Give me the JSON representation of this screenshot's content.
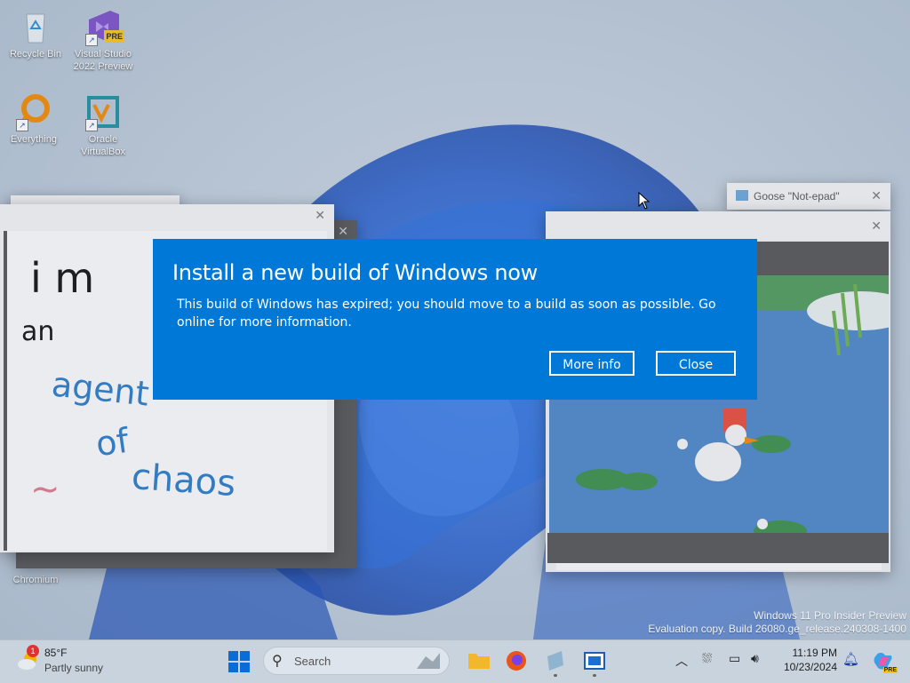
{
  "desktop": {
    "icons": [
      {
        "label_line1": "Recycle Bin",
        "label_line2": ""
      },
      {
        "label_line1": "Visual Studio",
        "label_line2": "2022 Preview",
        "badge": "PRE"
      },
      {
        "label_line1": "Everything",
        "label_line2": ""
      },
      {
        "label_line1": "Oracle",
        "label_line2": "VirtualBox"
      },
      {
        "label_line1": "Chromium",
        "label_line2": ""
      }
    ],
    "watermark_line1": "Windows 11 Pro Insider Preview",
    "watermark_line2": "Evaluation copy. Build 26080.ge_release.240308-1400"
  },
  "notepad_window": {
    "title": "Goose \"Not-epad\""
  },
  "drawing": {
    "line1": "i m",
    "line2": "an",
    "line3": "agent",
    "line4": "of",
    "line5": "chaos",
    "squiggle": "~"
  },
  "dialog": {
    "title": "Install a new build of Windows now",
    "message": "This build of Windows has expired; you should move to a build as soon as possible. Go online for more information.",
    "more_info_label": "More info",
    "close_label": "Close"
  },
  "taskbar": {
    "weather_temp": "85°F",
    "weather_desc": "Partly sunny",
    "weather_badge": "1",
    "search_placeholder": "Search",
    "time": "11:19 PM",
    "date": "10/23/2024",
    "copilot_badge": "PRE"
  },
  "colors": {
    "dialog_bg": "#0078d7",
    "accent": "#0078d7"
  }
}
